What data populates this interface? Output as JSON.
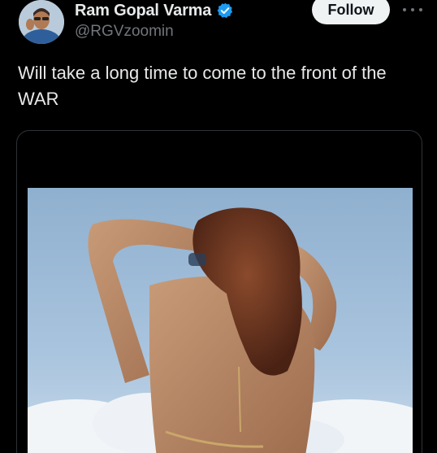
{
  "author": {
    "display_name": "Ram Gopal Varma",
    "handle": "@RGVzoomin",
    "verified": true,
    "verified_icon": "verified-badge-icon",
    "avatar_icon": "avatar"
  },
  "actions": {
    "follow_label": "Follow",
    "more_icon": "more-horizontal-icon"
  },
  "tweet": {
    "text": "Will take a long time to come to the front of the WAR"
  },
  "media": {
    "type": "image",
    "description_icon": "photo"
  },
  "colors": {
    "background": "#000000",
    "text_primary": "#e7e9ea",
    "text_secondary": "#71767b",
    "verified_blue": "#1d9bf0",
    "follow_bg": "#eff3f4",
    "card_border": "#2f3336"
  }
}
